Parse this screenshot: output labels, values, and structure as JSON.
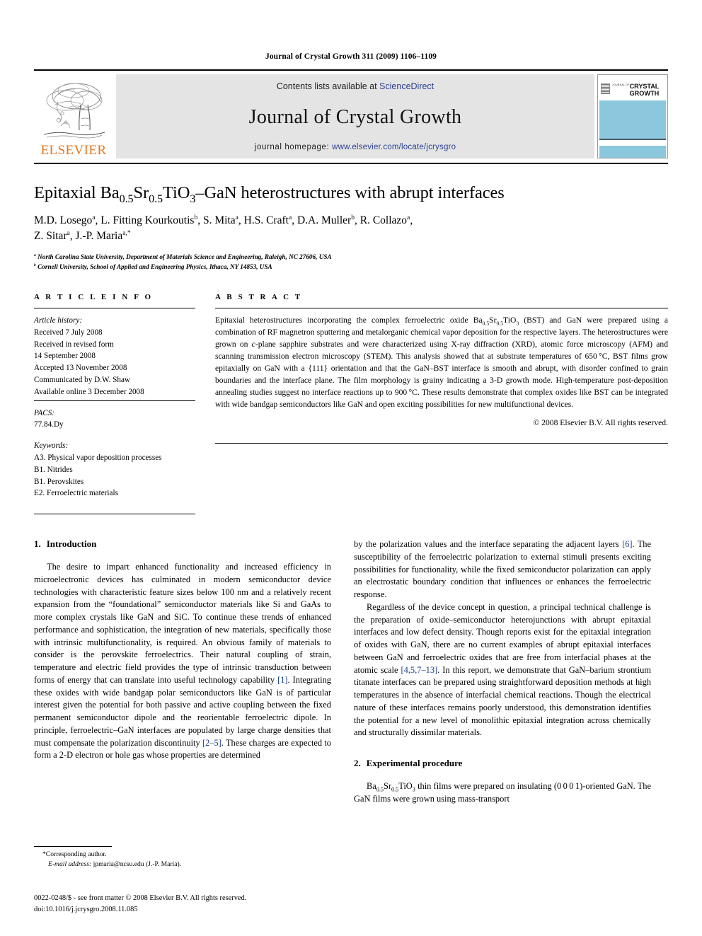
{
  "running_head": "Journal of Crystal Growth 311 (2009) 1106–1109",
  "masthead": {
    "elsevier_wordmark": "ELSEVIER",
    "contents_prefix": "Contents lists available at ",
    "contents_link": "ScienceDirect",
    "journal_title": "Journal of Crystal Growth",
    "homepage_prefix": "journal homepage: ",
    "homepage_url": "www.elsevier.com/locate/jcrysgro",
    "cover": {
      "small_label": "JOURNAL OF",
      "line1": "CRYSTAL",
      "line2": "GROWTH",
      "accent_color": "#8cc8dd"
    },
    "brand_color": "#E87722",
    "link_color": "#2b3f93"
  },
  "article": {
    "title_parts": {
      "p1": "Epitaxial Ba",
      "sub1": "0.5",
      "p2": "Sr",
      "sub2": "0.5",
      "p3": "TiO",
      "sub3": "3",
      "p4": "–GaN heterostructures with abrupt interfaces"
    },
    "authors_line1": "M.D. Losego a, L. Fitting Kourkoutis b, S. Mita a, H.S. Craft a, D.A. Muller b, R. Collazo a,",
    "authors_line2": "Z. Sitar a, J.-P. Maria a,*",
    "affiliations": [
      "a North Carolina State University, Department of Materials Science and Engineering, Raleigh, NC 27606, USA",
      "b Cornell University, School of Applied and Engineering Physics, Ithaca, NY 14853, USA"
    ]
  },
  "article_info": {
    "label": "A R T I C L E  I N F O",
    "history_label": "Article history:",
    "history": [
      "Received 7 July 2008",
      "Received in revised form",
      "14 September 2008",
      "Accepted 13 November 2008",
      "Communicated by D.W. Shaw",
      "Available online 3 December 2008"
    ],
    "pacs_label": "PACS:",
    "pacs": [
      "77.84.Dy"
    ],
    "keywords_label": "Keywords:",
    "keywords": [
      "A3. Physical vapor deposition processes",
      "B1. Nitrides",
      "B1. Perovskites",
      "E2. Ferroelectric materials"
    ]
  },
  "abstract": {
    "label": "A B S T R A C T",
    "text": "Epitaxial heterostructures incorporating the complex ferroelectric oxide Ba0.5Sr0.5TiO3 (BST) and GaN were prepared using a combination of RF magnetron sputtering and metalorganic chemical vapor deposition for the respective layers. The heterostructures were grown on c-plane sapphire substrates and were characterized using X-ray diffraction (XRD), atomic force microscopy (AFM) and scanning transmission electron microscopy (STEM). This analysis showed that at substrate temperatures of 650 °C, BST films grow epitaxially on GaN with a {111} orientation and that the GaN–BST interface is smooth and abrupt, with disorder confined to grain boundaries and the interface plane. The film morphology is grainy indicating a 3-D growth mode. High-temperature post-deposition annealing studies suggest no interface reactions up to 900 °C. These results demonstrate that complex oxides like BST can be integrated with wide bandgap semiconductors like GaN and open exciting possibilities for new multifunctional devices.",
    "copyright": "© 2008 Elsevier B.V. All rights reserved."
  },
  "sections": {
    "intro": {
      "number": "1.",
      "title": "Introduction",
      "p1_a": "The desire to impart enhanced functionality and increased efficiency in microelectronic devices has culminated in modern semiconductor device technologies with characteristic feature sizes below 100 nm and a relatively recent expansion from the “foundational” semiconductor materials like Si and GaAs to more complex crystals like GaN and SiC. To continue these trends of enhanced performance and sophistication, the integration of new materials, specifically those with intrinsic multifunctionality, is required. An obvious family of materials to consider is the perovskite ferroelectrics. Their natural coupling of strain, temperature and electric field provides the type of intrinsic transduction between forms of energy that can translate into useful technology capability ",
      "cite1": "[1]",
      "p1_b": ". Integrating these oxides with wide bandgap polar semiconductors like GaN is of particular interest given the potential for both passive and active coupling between the fixed permanent semiconductor dipole and the reorientable ferroelectric dipole. In principle, ferroelectric–GaN interfaces are populated by large charge densities that must compensate the polarization discontinuity ",
      "cite2": "[2–5]",
      "p1_c": ". These charges are expected to form a 2-D electron or hole gas whose properties are determined by the polarization values and the interface separating the adjacent layers ",
      "cite3": "[6]",
      "p1_d": ". The susceptibility of the ferroelectric polarization to external stimuli presents exciting possibilities for functionality, while the fixed semiconductor polarization can apply an electrostatic boundary condition that influences or enhances the ferroelectric response.",
      "p2_a": "Regardless of the device concept in question, a principal technical challenge is the preparation of oxide–semiconductor heterojunctions with abrupt epitaxial interfaces and low defect density. Though reports exist for the epitaxial integration of oxides with GaN, there are no current examples of abrupt epitaxial interfaces between GaN and ferroelectric oxides that are free from interfacial phases at the atomic scale ",
      "cite4": "[4,5,7–13]",
      "p2_b": ". In this report, we demonstrate that GaN–barium strontium titanate interfaces can be prepared using straightforward deposition methods at high temperatures in the absence of interfacial chemical reactions. Though the electrical nature of these interfaces remains poorly understood, this demonstration identifies the potential for a new level of monolithic epitaxial integration across chemically and structurally dissimilar materials."
    },
    "experimental": {
      "number": "2.",
      "title": "Experimental procedure",
      "p1": "Ba0.5Sr0.5TiO3 thin films were prepared on insulating (0 0 0 1)-oriented GaN. The GaN films were grown using mass-transport"
    }
  },
  "footnote": {
    "corresponding": "*Corresponding author.",
    "email_label": "E-mail address:",
    "email": "jpmaria@ncsu.edu (J.-P. Maria)."
  },
  "footer": {
    "line1": "0022-0248/$ - see front matter © 2008 Elsevier B.V. All rights reserved.",
    "line2": "doi:10.1016/j.jcrysgro.2008.11.085"
  }
}
